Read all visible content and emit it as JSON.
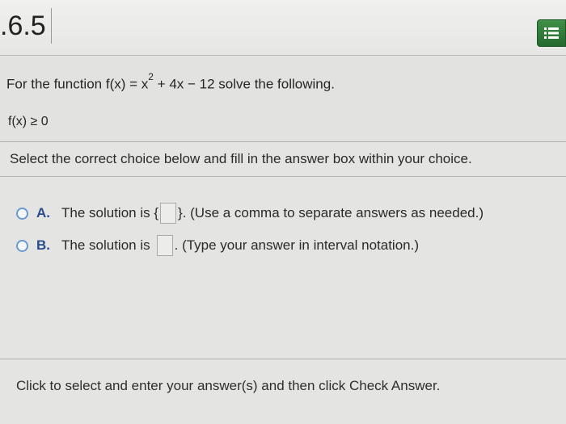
{
  "header": {
    "section_number": ".6.5",
    "menu_icon": "menu-list-icon"
  },
  "problem": {
    "prefix": "For the function f(x) = x",
    "exponent": "2",
    "suffix": " + 4x − 12 solve the following.",
    "condition": "f(x) ≥ 0"
  },
  "instruction": "Select the correct choice below and fill in the answer box within your choice.",
  "choices": [
    {
      "letter": "A.",
      "before": "The solution is {",
      "after": "}. (Use a comma to separate answers as needed.)"
    },
    {
      "letter": "B.",
      "before": "The solution is",
      "after": ". (Type your answer in interval notation.)"
    }
  ],
  "footer": "Click to select and enter your answer(s) and then click Check Answer.",
  "colors": {
    "menu_button": "#2f7a39",
    "radio_border": "#6a9ad0",
    "choice_letter": "#2a4c8a"
  }
}
